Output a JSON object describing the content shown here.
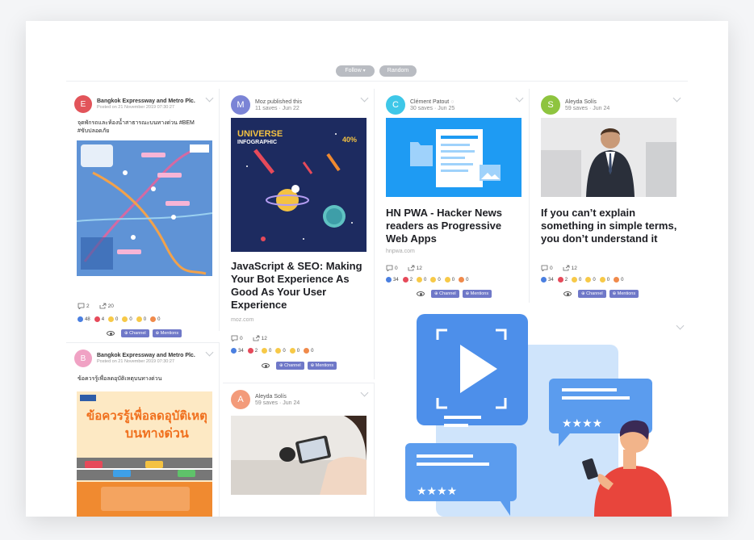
{
  "toolbar": {
    "follow": "Follow",
    "random": "Random"
  },
  "cards": [
    {
      "author": "Bangkok Expressway and Metro Plc.",
      "sub": "Posted on 21 November 2019 07:30:27",
      "avatar": "E",
      "avatar_color": "#e2545a",
      "text": "จุดพักรถและห้องน้ำสาธารณะบนทางด่วน #BEM #ขับปลอดภัย",
      "comments": "2",
      "shares": "20",
      "reactions": [
        "48",
        "4",
        "0",
        "0",
        "0",
        "0"
      ],
      "channel": "Channel",
      "mentions": "Mentions"
    },
    {
      "author": "Moz published this",
      "sub": "11 saves · Jun 22",
      "avatar": "M",
      "avatar_color": "#7b84d6",
      "title": "JavaScript & SEO: Making Your Bot Experience As Good As Your User Experience",
      "domain": "moz.com",
      "comments": "0",
      "shares": "12",
      "reactions": [
        "34",
        "2",
        "0",
        "0",
        "0",
        "0"
      ],
      "channel": "Channel",
      "mentions": "Mentions",
      "img_title1": "UNIVERSE",
      "img_title2": "INFOGRAPHIC",
      "img_pct": "40%"
    },
    {
      "author": "Clément Patout",
      "sub": "30 saves · Jun 25",
      "avatar": "C",
      "avatar_color": "#3ec7e8",
      "title": "HN PWA - Hacker News readers as Progressive Web Apps",
      "domain": "hnpwa.com",
      "comments": "0",
      "shares": "12",
      "reactions": [
        "34",
        "2",
        "0",
        "0",
        "0",
        "0"
      ],
      "channel": "Channel",
      "mentions": "Mentions"
    },
    {
      "author": "Aleyda Solís",
      "sub": "59 saves · Jun 24",
      "avatar": "S",
      "avatar_color": "#8ec43f",
      "title": "If you can’t explain something in simple terms, you don’t understand it",
      "comments": "0",
      "shares": "12",
      "reactions": [
        "34",
        "2",
        "0",
        "0",
        "0",
        "0"
      ],
      "channel": "Channel",
      "mentions": "Mentions"
    },
    {
      "author": "Bangkok Expressway and Metro Plc.",
      "sub": "Posted on 21 November 2019 07:30:27",
      "avatar": "B",
      "avatar_color": "#f0a2c4",
      "text": "ข้อควรรู้เพื่อลดอุบัติเหตุบนทางด่วน",
      "img_heading1": "ข้อควรรู้เพื่อลดอุบัติเหตุ",
      "img_heading2": "บนทางด่วน"
    },
    {
      "author": "Aleyda Solís",
      "sub": "59 saves · Jun 24",
      "avatar": "A",
      "avatar_color": "#f39b7a"
    }
  ],
  "colors": {
    "accent": "#6f78c8",
    "like": "#4a7fe0",
    "love": "#e64a5a",
    "emoji": "#f7c948",
    "angry": "#f08a4b"
  }
}
